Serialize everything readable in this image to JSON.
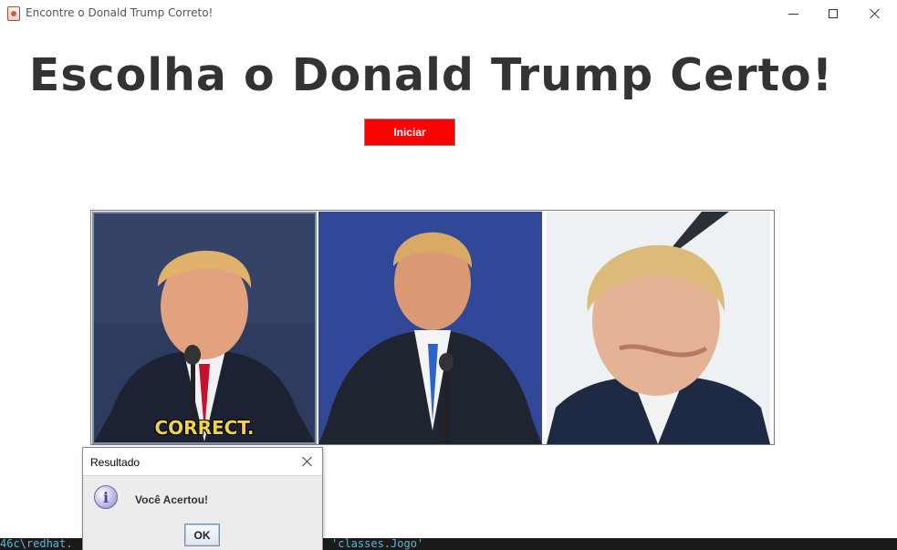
{
  "window": {
    "title": "Encontre o Donald Trump Correto!",
    "icon": "java-cup-icon"
  },
  "main": {
    "heading": "Escolha o Donald Trump Certo!",
    "start_button": "Iniciar",
    "start_button_color": "#ff0000",
    "pictures": [
      {
        "name": "trump-image-1",
        "caption": "CORRECT.",
        "selected": true
      },
      {
        "name": "trump-image-2",
        "caption": ""
      },
      {
        "name": "trump-image-3",
        "caption": ""
      }
    ]
  },
  "terminal": {
    "left_text": "46c\\redhat.",
    "right_text": "'classes.Jogo'"
  },
  "dialog": {
    "title": "Resultado",
    "message": "Você Acertou!",
    "ok_label": "OK",
    "icon": "info-icon"
  }
}
